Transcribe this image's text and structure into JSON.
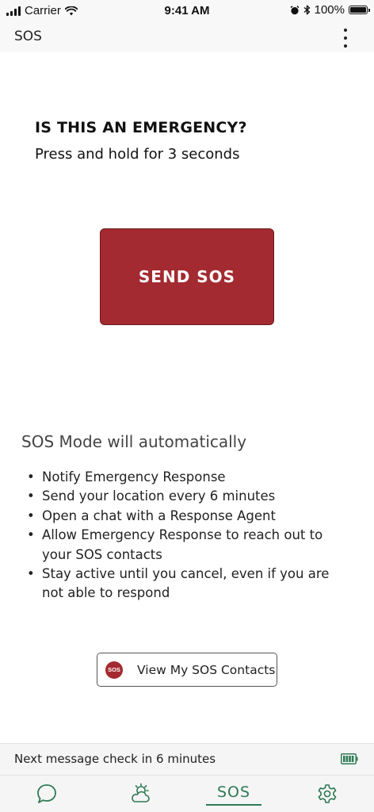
{
  "status_bar": {
    "carrier": "Carrier",
    "time": "9:41 AM",
    "battery_percent": "100%"
  },
  "app_bar": {
    "title": "SOS",
    "menu_icon": "more-vertical-icon"
  },
  "main": {
    "question": "IS THIS AN EMERGENCY?",
    "instruction": "Press and hold for 3 seconds",
    "send_button_label": "SEND SOS",
    "send_button_color": "#a32a30",
    "mode_heading": "SOS Mode will automatically",
    "mode_items": [
      "Notify Emergency Response",
      "Send your location every 6 minutes",
      "Open a chat with a Response Agent",
      "Allow Emergency Response to reach out to your SOS contacts",
      "Stay active until you cancel, even if you are not able to respond"
    ],
    "contacts_button": {
      "badge_text": "SOS",
      "label": "View My SOS Contacts"
    }
  },
  "info_bar": {
    "text": "Next message check in 6 minutes",
    "battery_icon": "battery-full-icon",
    "battery_color": "#2f7a55"
  },
  "tab_bar": {
    "accent_color": "#2f7a55",
    "tabs": [
      {
        "icon": "chat-bubble-icon",
        "label": ""
      },
      {
        "icon": "weather-icon",
        "label": ""
      },
      {
        "icon": "",
        "label": "SOS",
        "active": true
      },
      {
        "icon": "gear-icon",
        "label": ""
      }
    ]
  }
}
